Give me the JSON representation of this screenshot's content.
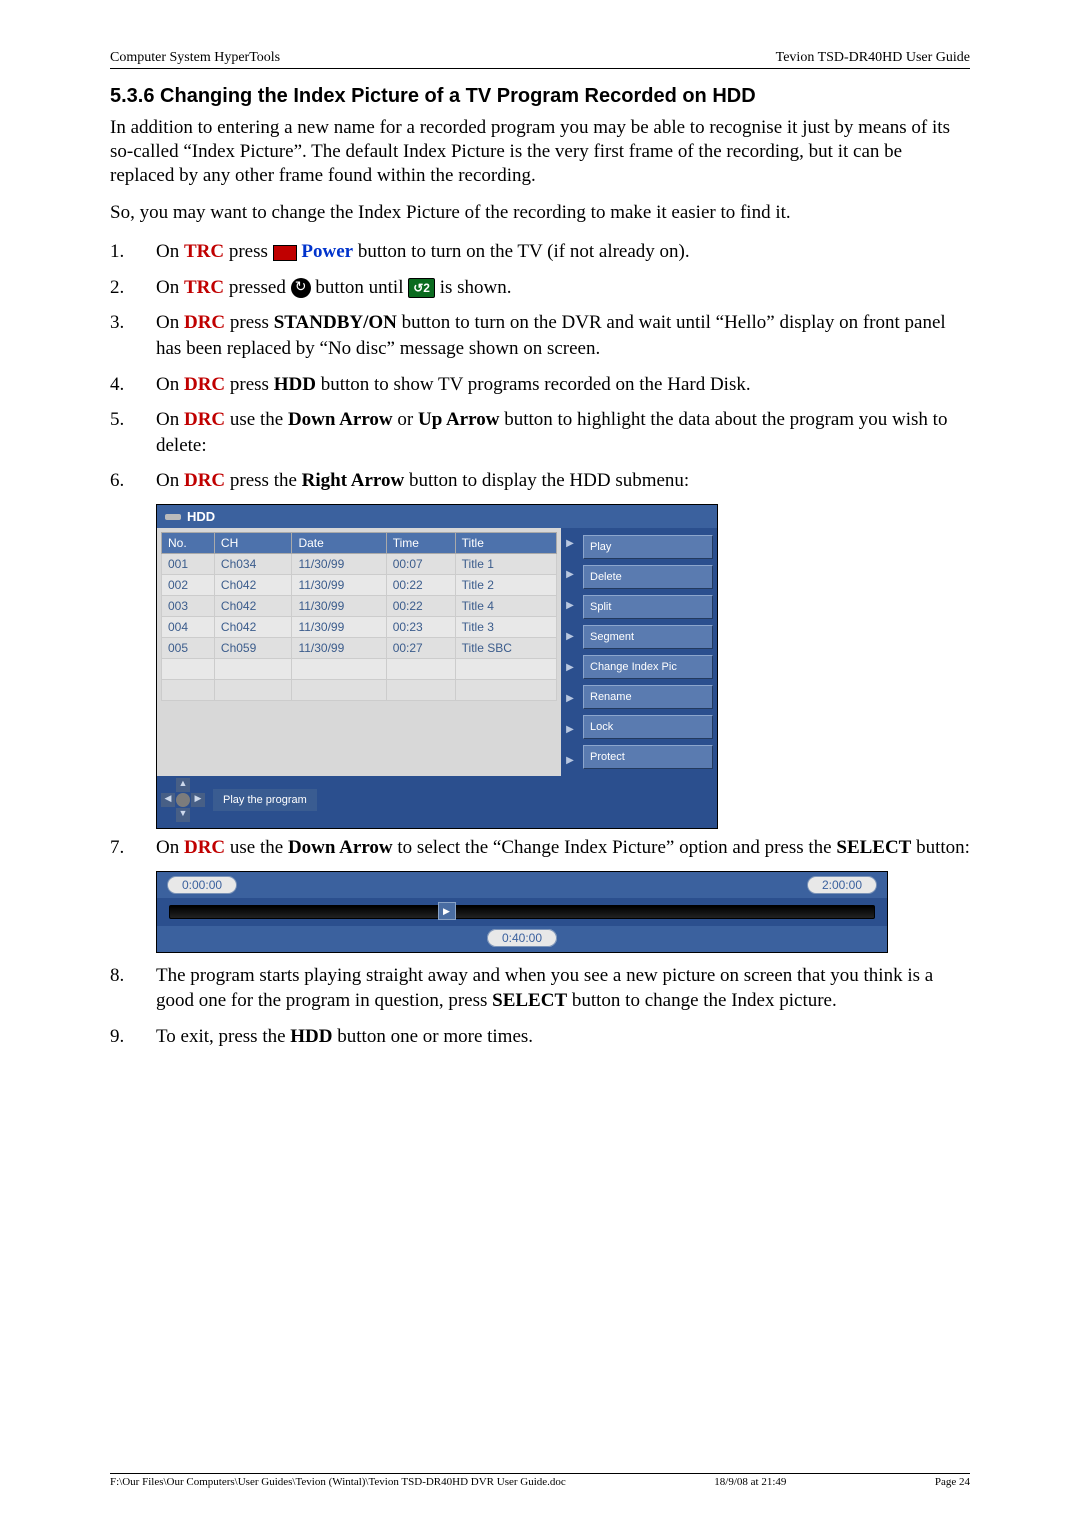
{
  "header": {
    "left": "Computer System HyperTools",
    "right": "Tevion TSD-DR40HD User Guide"
  },
  "section_title": "5.3.6  Changing the Index Picture of a TV Program Recorded on HDD",
  "intro1": "In addition to entering a new name for a recorded program you may be able to recognise it just by means of its so-called “Index Picture”. The default Index Picture is the very first frame of the recording, but it can be replaced by any other frame found within the recording.",
  "intro2": "So, you may want to change the Index Picture of the recording to make it easier to find it.",
  "steps": {
    "s1": {
      "num": "1.",
      "a": "On ",
      "trc": "TRC",
      "b": " press ",
      "power": "Power",
      "c": " button to turn on the TV (if not already on)."
    },
    "s2": {
      "num": "2.",
      "a": "On ",
      "trc": "TRC",
      "b": " pressed ",
      "c": " button until ",
      "badge": "↺2",
      "d": " is shown."
    },
    "s3": {
      "num": "3.",
      "a": "On ",
      "drc": "DRC",
      "b": " press ",
      "standby": "STANDBY/ON",
      "c": " button to turn on the DVR and wait until “Hello” display on front panel has been replaced by “No disc” message shown on screen."
    },
    "s4": {
      "num": "4.",
      "a": "On ",
      "drc": "DRC",
      "b": " press ",
      "hdd": "HDD",
      "c": " button to show TV programs recorded on the Hard Disk."
    },
    "s5": {
      "num": "5.",
      "a": "On ",
      "drc": "DRC",
      "b": " use the ",
      "down": "Down Arrow",
      "or": " or ",
      "up": "Up Arrow",
      "c": " button to highlight the data about the program you wish to delete:"
    },
    "s6": {
      "num": "6.",
      "a": "On ",
      "drc": "DRC",
      "b": " press the ",
      "right": "Right Arrow",
      "c": " button to display the HDD submenu:"
    },
    "s7": {
      "num": "7.",
      "a": "On ",
      "drc": "DRC",
      "b": " use the ",
      "down": "Down Arrow",
      "c": " to select the “Change Index Picture” option and press the ",
      "select": "SELECT",
      "d": " button:"
    },
    "s8": {
      "num": "8.",
      "a": "The program starts playing straight away and when you see a new picture on screen that you think is a good one for the program in question, press ",
      "select": "SELECT",
      "b": " button to change the Index picture."
    },
    "s9": {
      "num": "9.",
      "a": "To exit, press the ",
      "hdd": "HDD",
      "b": " button one or more times."
    }
  },
  "hdd": {
    "title": "HDD",
    "headers": {
      "no": "No.",
      "ch": "CH",
      "date": "Date",
      "time": "Time",
      "title": "Title"
    },
    "rows": [
      {
        "no": "001",
        "ch": "Ch034",
        "date": "11/30/99",
        "time": "00:07",
        "title": "Title 1"
      },
      {
        "no": "002",
        "ch": "Ch042",
        "date": "11/30/99",
        "time": "00:22",
        "title": "Title 2"
      },
      {
        "no": "003",
        "ch": "Ch042",
        "date": "11/30/99",
        "time": "00:22",
        "title": "Title 4"
      },
      {
        "no": "004",
        "ch": "Ch042",
        "date": "11/30/99",
        "time": "00:23",
        "title": "Title 3"
      },
      {
        "no": "005",
        "ch": "Ch059",
        "date": "11/30/99",
        "time": "00:27",
        "title": "Title SBC"
      }
    ],
    "menu": [
      "Play",
      "Delete",
      "Split",
      "Segment",
      "Change Index Pic",
      "Rename",
      "Lock",
      "Protect"
    ],
    "hint": "Play the program"
  },
  "timeline": {
    "start": "0:00:00",
    "pos": "0:40:00",
    "end": "2:00:00"
  },
  "footer": {
    "path": "F:\\Our Files\\Our Computers\\User Guides\\Tevion (Wintal)\\Tevion TSD-DR40HD DVR User Guide.doc",
    "date": "18/9/08 at 21:49",
    "page": "Page 24"
  }
}
